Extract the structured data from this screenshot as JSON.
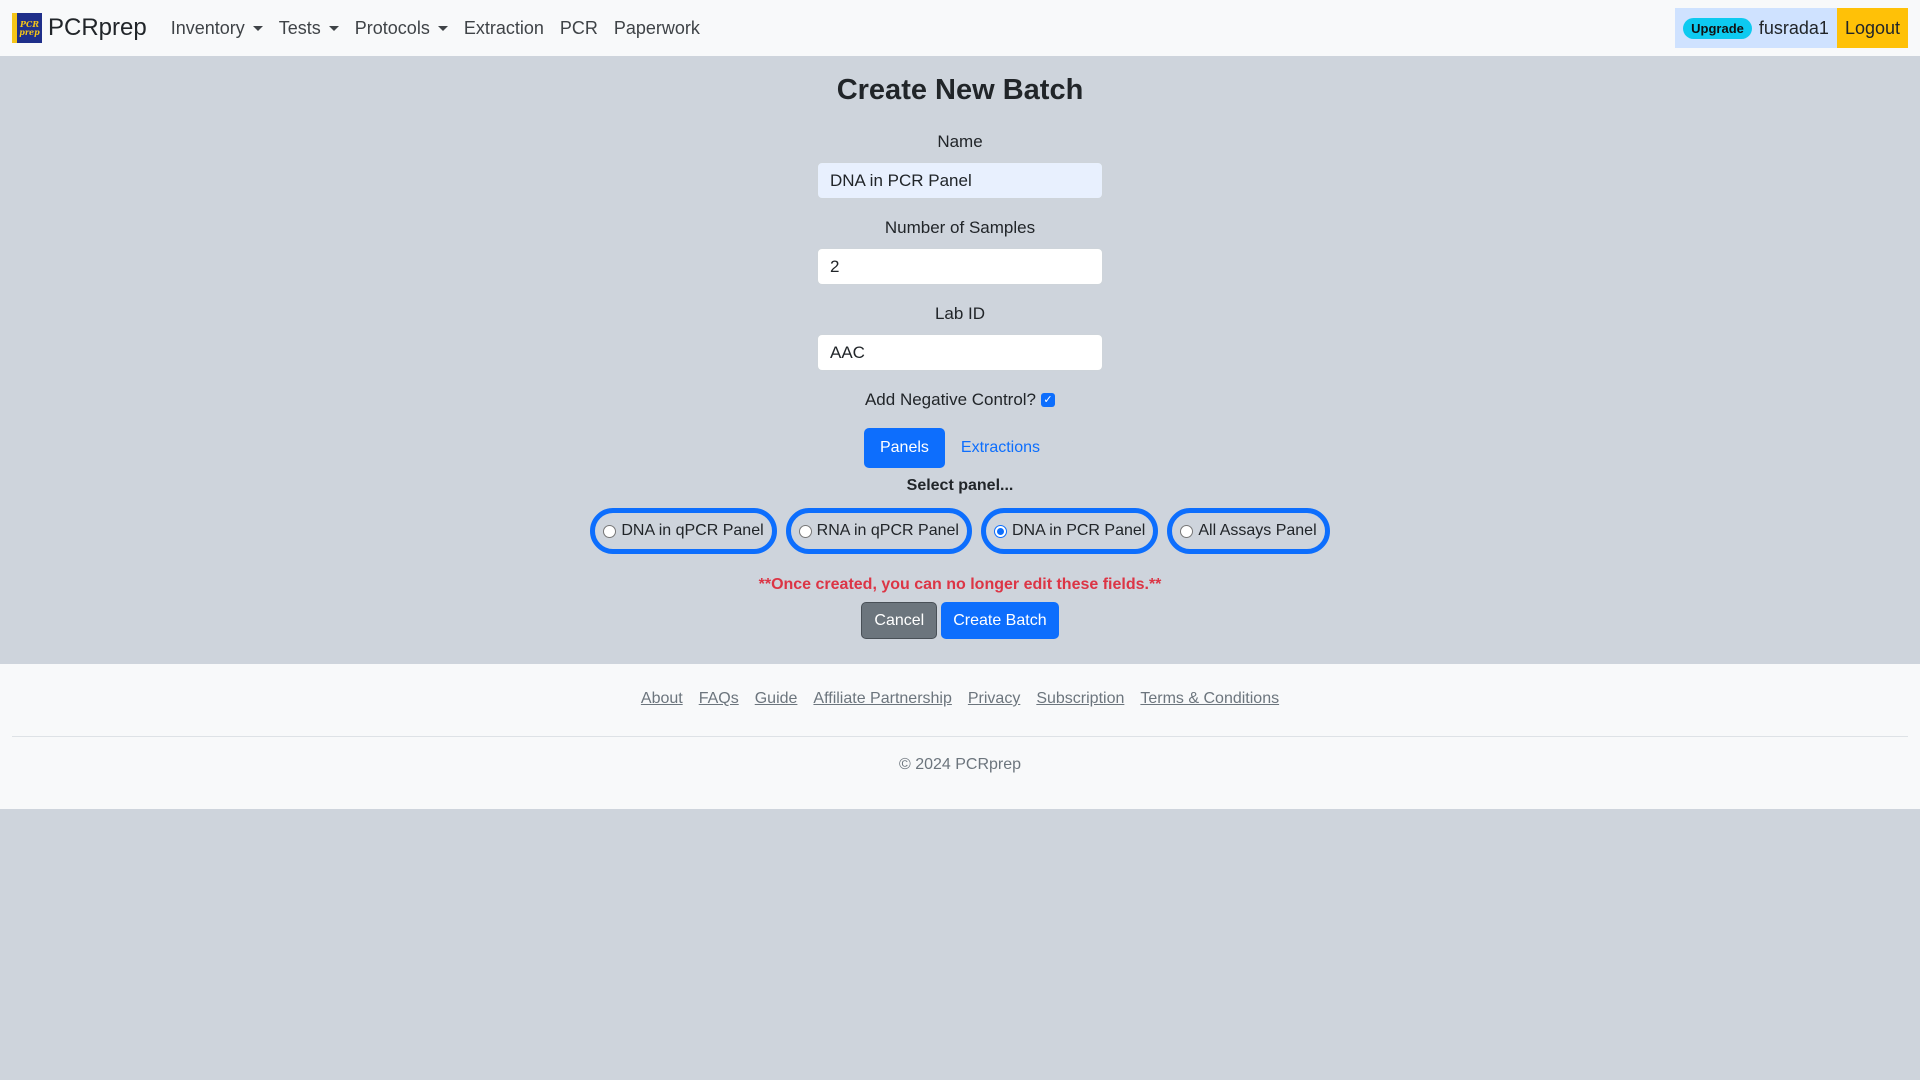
{
  "navbar": {
    "brand": "PCRprep",
    "logo_text": "PCR prep",
    "items": [
      {
        "label": "Inventory",
        "dropdown": true
      },
      {
        "label": "Tests",
        "dropdown": true
      },
      {
        "label": "Protocols",
        "dropdown": true
      },
      {
        "label": "Extraction",
        "dropdown": false
      },
      {
        "label": "PCR",
        "dropdown": false
      },
      {
        "label": "Paperwork",
        "dropdown": false
      }
    ],
    "upgrade_badge": "Upgrade",
    "username": "fusrada1",
    "logout_label": "Logout"
  },
  "form": {
    "title": "Create New Batch",
    "name_label": "Name",
    "name_value": "DNA in PCR Panel",
    "samples_label": "Number of Samples",
    "samples_value": "2",
    "lab_id_label": "Lab ID",
    "lab_id_value": "AAC",
    "negative_control_label": "Add Negative Control?",
    "negative_control_checked": true,
    "tabs": [
      {
        "label": "Panels",
        "active": true
      },
      {
        "label": "Extractions",
        "active": false
      }
    ],
    "select_panel_label": "Select panel...",
    "panels": [
      {
        "label": "DNA in qPCR Panel",
        "checked": false
      },
      {
        "label": "RNA in qPCR Panel",
        "checked": false
      },
      {
        "label": "DNA in PCR Panel",
        "checked": true
      },
      {
        "label": "All Assays Panel",
        "checked": false
      }
    ],
    "warning": "**Once created, you can no longer edit these fields.**",
    "cancel_label": "Cancel",
    "submit_label": "Create Batch"
  },
  "footer": {
    "links": [
      "About",
      "FAQs",
      "Guide",
      "Affiliate Partnership",
      "Privacy",
      "Subscription",
      "Terms & Conditions"
    ],
    "copyright": "© 2024 PCRprep"
  },
  "colors": {
    "primary": "#0d6efd",
    "warning_text": "#dc3545",
    "logout_bg": "#ffc107",
    "upgrade_badge_bg": "#0dcaf0",
    "page_bg": "#ced4dc"
  }
}
